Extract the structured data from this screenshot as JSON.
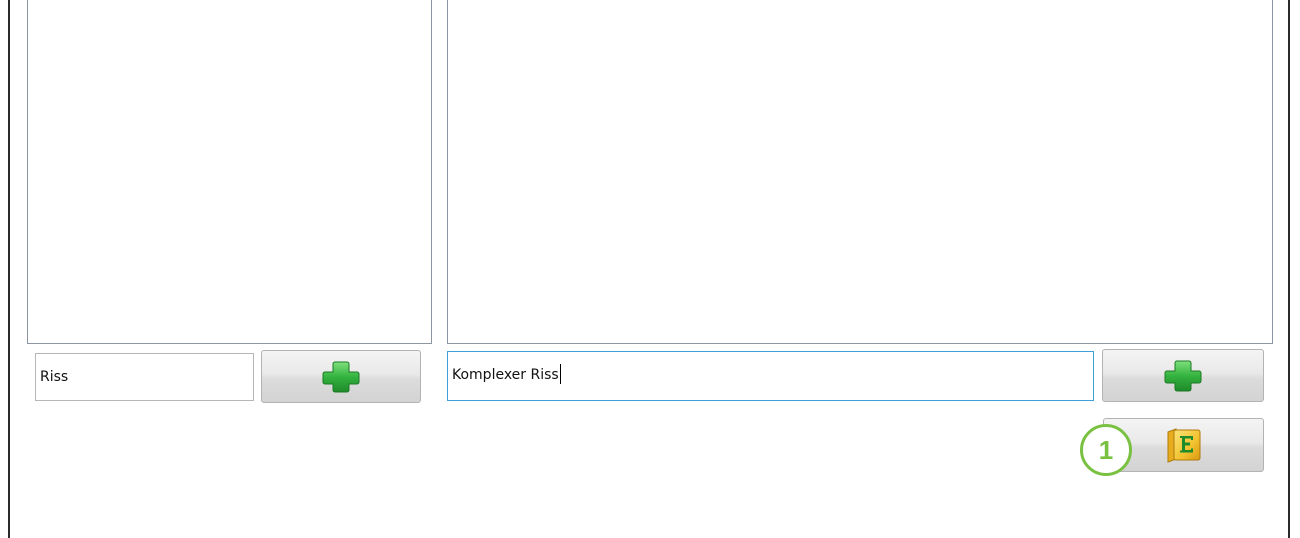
{
  "left_column": {
    "input_value": "Riss",
    "add_button_icon": "green-plus-icon"
  },
  "right_column": {
    "input_value": "Komplexer Riss",
    "add_button_icon": "green-plus-icon",
    "export_button_icon": "folder-e-icon"
  },
  "callout": {
    "number": "1"
  },
  "colors": {
    "plus_green": "#3cb54a",
    "callout_green": "#7ac142",
    "focus_border": "#3fa0d8",
    "folder_yellow": "#f2c12e"
  }
}
